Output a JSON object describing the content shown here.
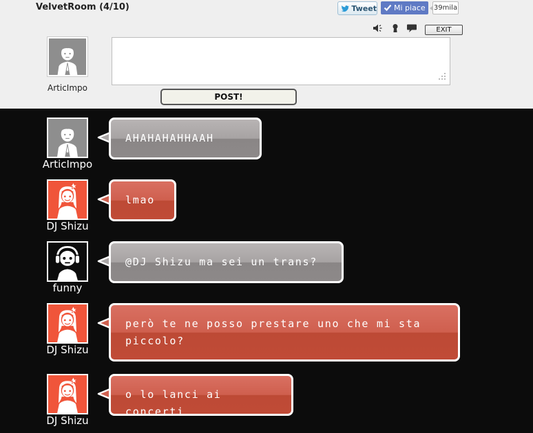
{
  "room": {
    "title": "VelvetRoom (4/10)"
  },
  "social": {
    "tweet_label": "Tweet",
    "like_label": "Mi piace",
    "like_count": "39mila"
  },
  "toolbar": {
    "sound_icon": "speaker-icon",
    "keyhole_icon": "keyhole-icon",
    "speech_icon": "speech-bubble-icon",
    "exit_label": "EXIT"
  },
  "composer": {
    "username": "ArticImpo",
    "input_value": "",
    "post_label": "POST!"
  },
  "colors": {
    "panel": "#efefef",
    "chat_bg": "#0c0c0c",
    "gray_bubble": "#9f9b9b",
    "red_bubble": "#c8533f",
    "red_avatar": "#f0553a"
  },
  "messages": [
    {
      "user": "ArticImpo",
      "avatar": "gray-man-avatar",
      "color": "gray",
      "text": "AHAHAHAHHAAH"
    },
    {
      "user": "DJ Shizu",
      "avatar": "red-girl-avatar",
      "color": "red",
      "text": "lmao"
    },
    {
      "user": "funny",
      "avatar": "headphones-avatar",
      "color": "gray",
      "text": "@DJ Shizu ma sei un trans?"
    },
    {
      "user": "DJ Shizu",
      "avatar": "red-girl-avatar",
      "color": "red",
      "text": "però te ne posso prestare uno che mi sta piccolo?"
    },
    {
      "user": "DJ Shizu",
      "avatar": "red-girl-avatar",
      "color": "red",
      "text": "o lo lanci ai concerti"
    }
  ]
}
